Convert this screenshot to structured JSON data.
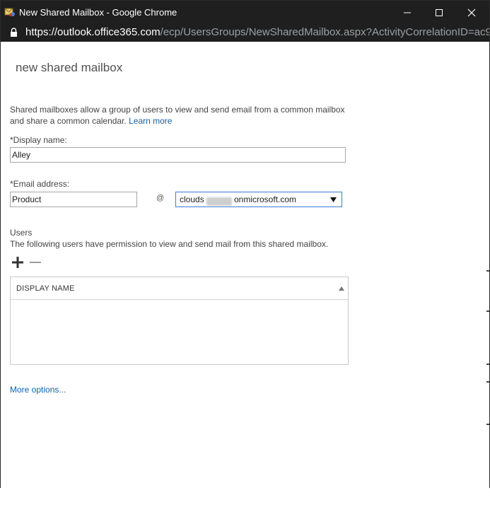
{
  "window": {
    "title": "New Shared Mailbox - Google Chrome",
    "url_host": "https://outlook.office365.com",
    "url_path": "/ecp/UsersGroups/NewSharedMailbox.aspx?ActivityCorrelationID=ac90..."
  },
  "form": {
    "page_title": "new shared mailbox",
    "description": "Shared mailboxes allow a group of users to view and send email from a common mailbox and share a common calendar.",
    "learn_more": "Learn more",
    "display_name_label": "*Display name:",
    "display_name_value": "Alley",
    "email_label": "*Email address:",
    "email_alias_value": "Product",
    "at_symbol": "@",
    "domain_prefix": "clouds",
    "domain_suffix": "onmicrosoft.com",
    "users_title": "Users",
    "users_desc": "The following users have permission to view and send mail from this shared mailbox.",
    "grid_header": "DISPLAY NAME",
    "more_options": "More options..."
  },
  "colors": {
    "chrome_dark": "#1f1f1f",
    "link_blue": "#0f62ac",
    "focus_border": "#3a7bd5"
  },
  "icons": {
    "app": "mailbox-app-icon",
    "minimize": "minimize-icon",
    "maximize": "maximize-icon",
    "close": "close-icon",
    "lock": "lock-icon",
    "dropdown": "triangle-down-icon",
    "add": "plus-icon",
    "remove": "minus-icon",
    "sort": "triangle-up-icon"
  }
}
